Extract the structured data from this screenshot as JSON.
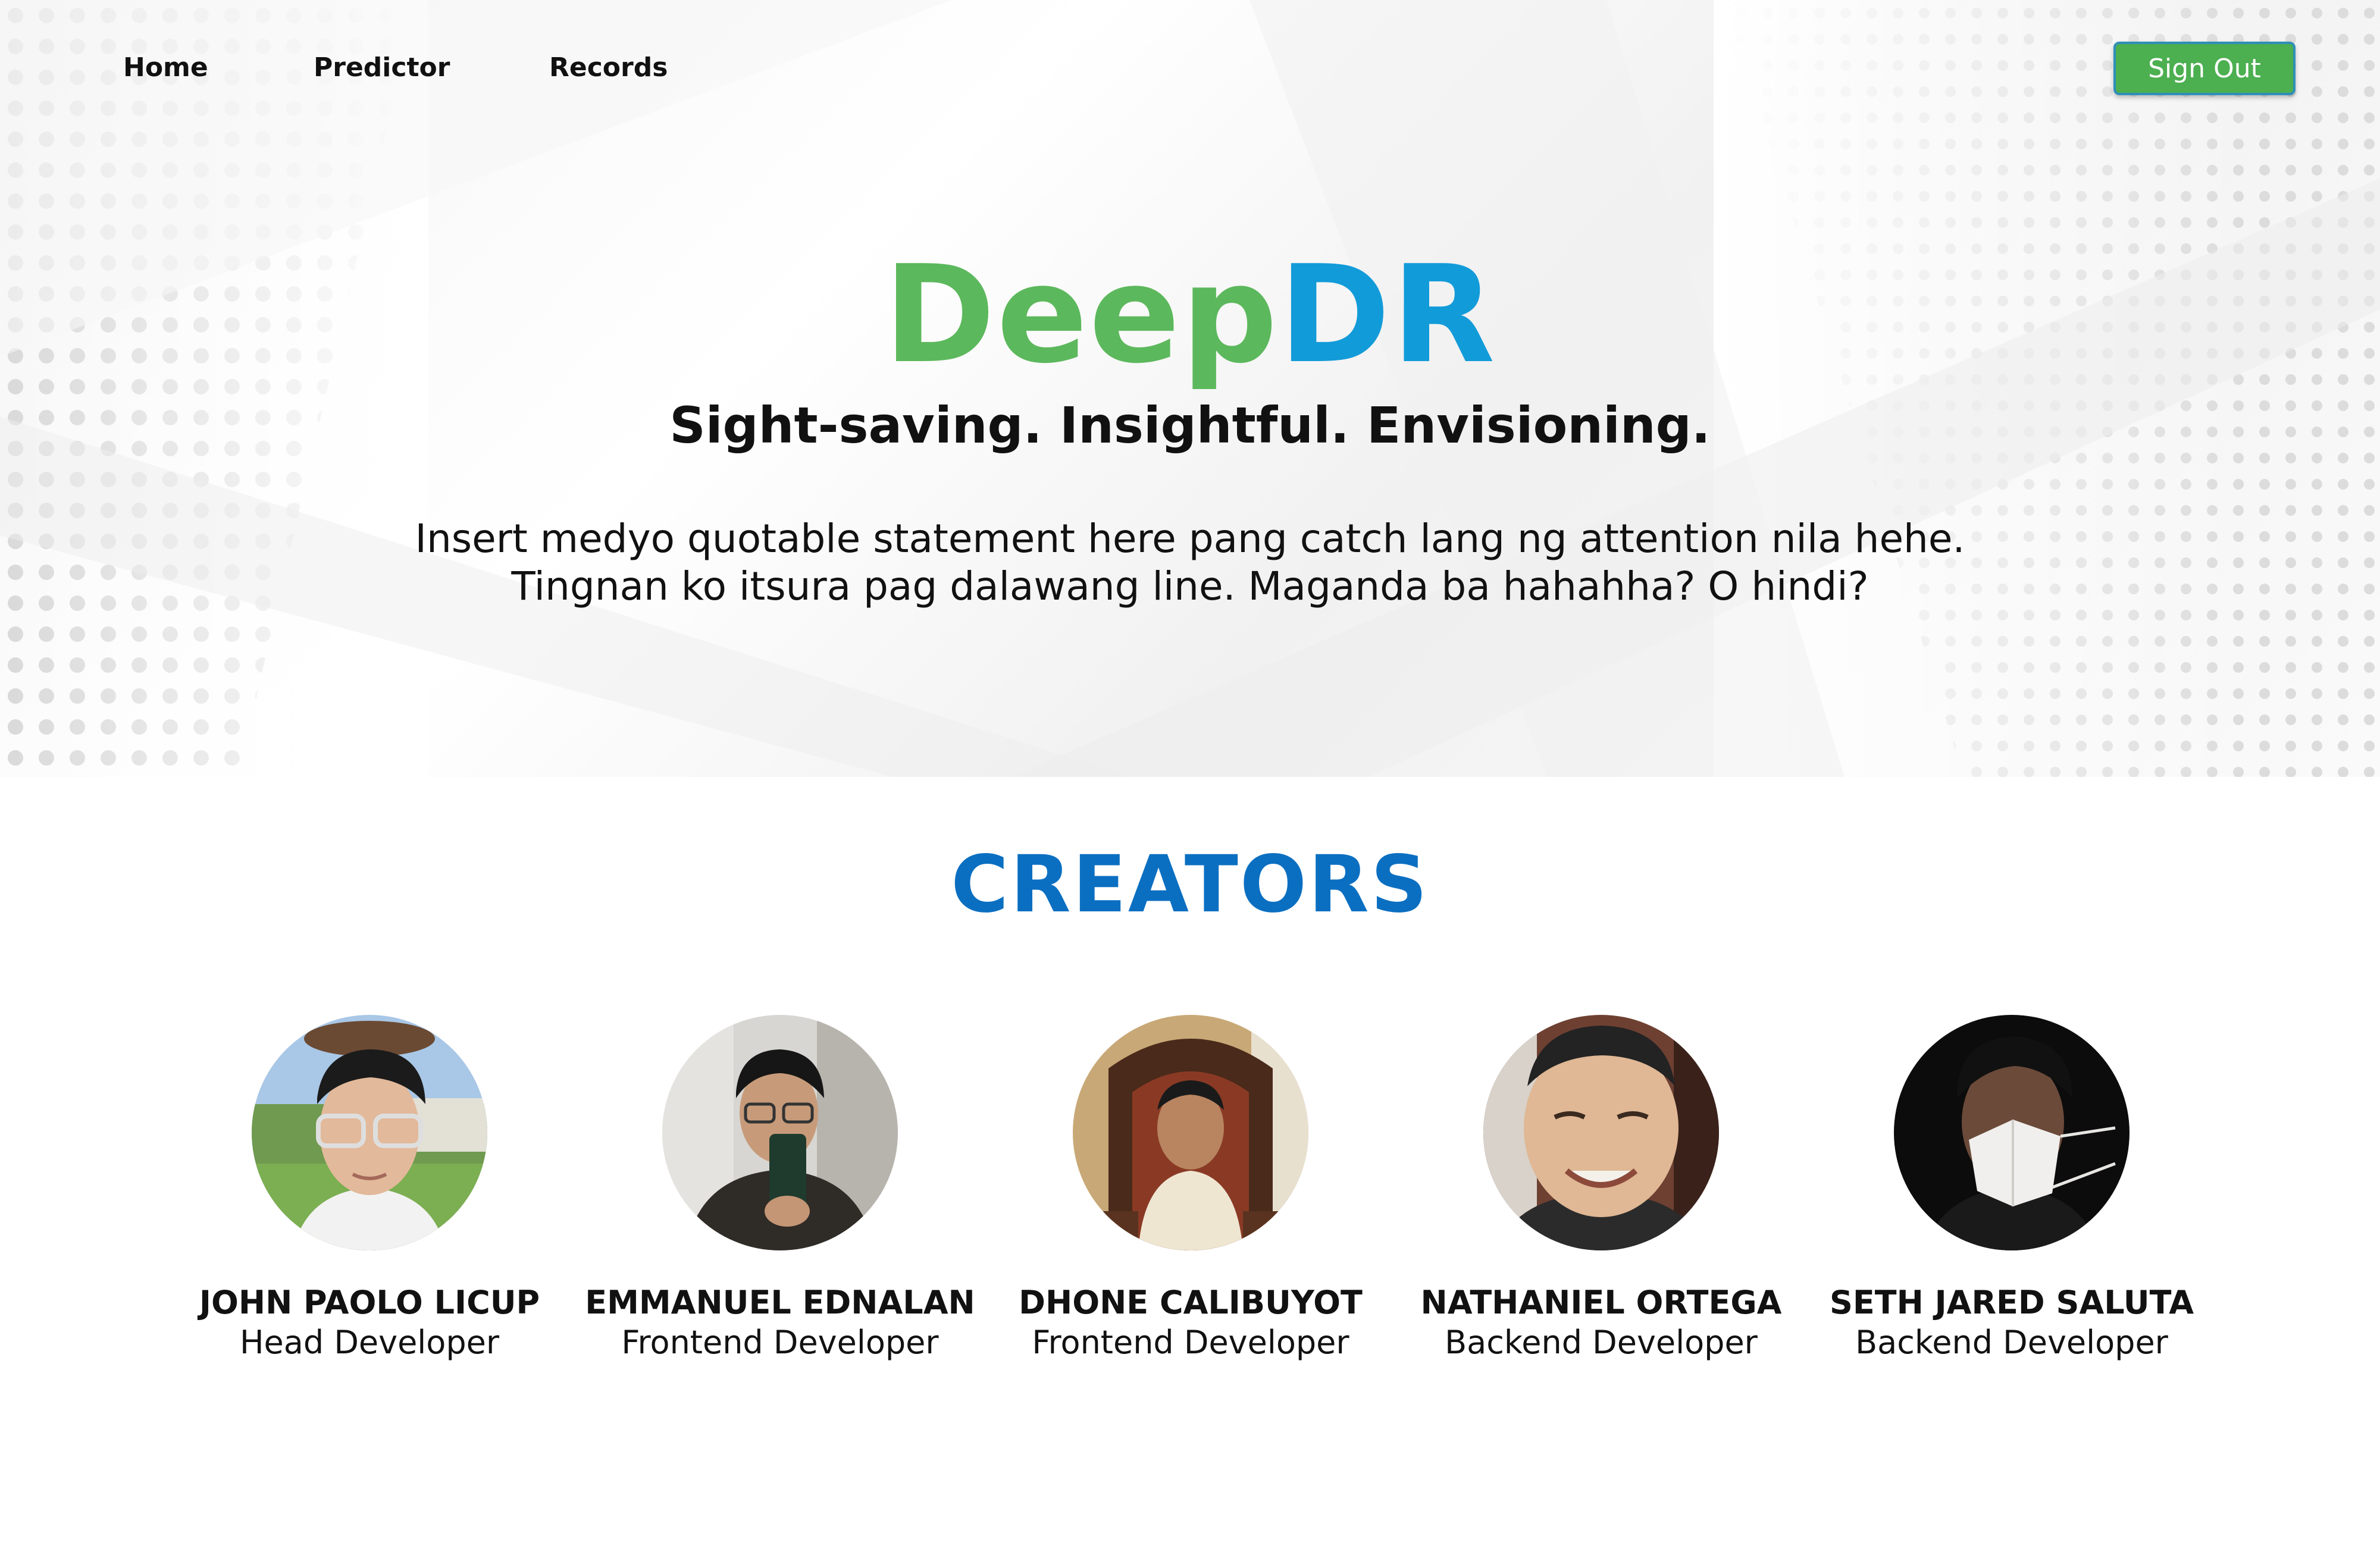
{
  "nav": {
    "home": "Home",
    "predictor": "Predictor",
    "records": "Records",
    "sign_out": "Sign Out"
  },
  "hero": {
    "brand_part1": "Deep",
    "brand_part2": "DR",
    "tagline": "Sight-saving. Insightful. Envisioning.",
    "quote_line1": "Insert medyo quotable statement here pang catch lang ng attention nila hehe.",
    "quote_line2": "Tingnan ko itsura pag dalawang line. Maganda ba hahahha? O hindi?"
  },
  "creators": {
    "title": "CREATORS",
    "people": [
      {
        "name": "JOHN PAOLO LICUP",
        "role": "Head Developer"
      },
      {
        "name": "EMMANUEL EDNALAN",
        "role": "Frontend Developer"
      },
      {
        "name": "DHONE CALIBUYOT",
        "role": "Frontend Developer"
      },
      {
        "name": "NATHANIEL ORTEGA",
        "role": "Backend Developer"
      },
      {
        "name": "SETH JARED SALUTA",
        "role": "Backend Developer"
      }
    ]
  },
  "colors": {
    "brand_green": "#5cb85c",
    "brand_blue": "#129bd9",
    "creators_blue": "#0b6fc1",
    "button_green": "#4caf50"
  }
}
